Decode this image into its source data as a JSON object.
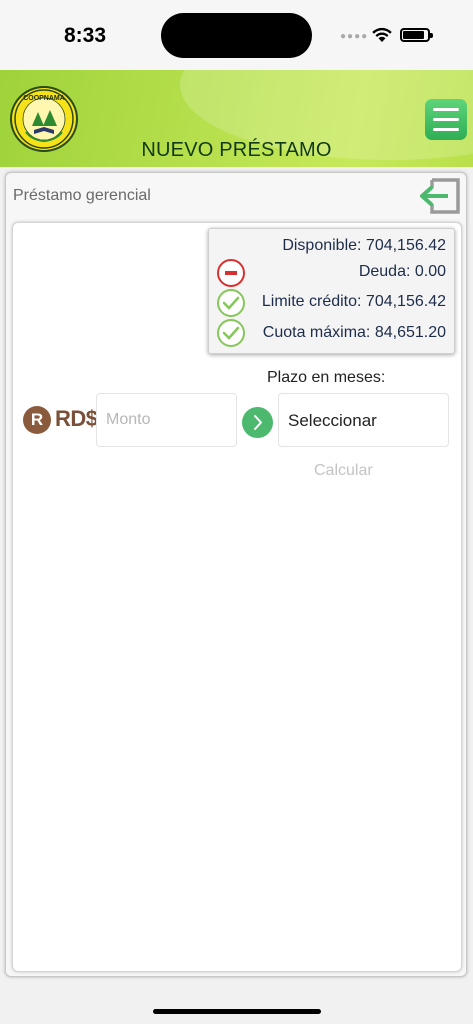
{
  "status_bar": {
    "time": "8:33",
    "signal_icon": "cellular-dots-icon",
    "wifi_icon": "wifi-icon",
    "battery_icon": "battery-icon"
  },
  "header": {
    "logo_text": "COOPNAMA",
    "title": "NUEVO PRÉSTAMO",
    "menu_icon": "hamburger-menu-icon",
    "colors": {
      "gradient_start": "#9fd33a",
      "gradient_end": "#c6e95a",
      "menu_button": "#3cbf63",
      "title": "#123a12"
    }
  },
  "panel": {
    "title": "Préstamo gerencial",
    "logout_icon": "logout-arrow-icon"
  },
  "summary": {
    "disponible": "Disponible: 704,156.42",
    "deuda": "Deuda: 0.00",
    "limite_credito": "Limite crédito: 704,156.42",
    "cuota_maxima": "Cuota máxima: 84,651.20",
    "deuda_icon": "minus-circle-icon",
    "check_icon": "check-circle-icon",
    "colors": {
      "debt": "#d83030",
      "check": "#86c65a"
    }
  },
  "form": {
    "currency_symbol": "R",
    "currency_label": "RD$",
    "amount_placeholder": "Monto",
    "amount_value": "",
    "go_icon": "chevron-right-circle-icon",
    "plazo_label": "Plazo en meses:",
    "plazo_selected": "Seleccionar",
    "calculate_label": "Calcular"
  }
}
